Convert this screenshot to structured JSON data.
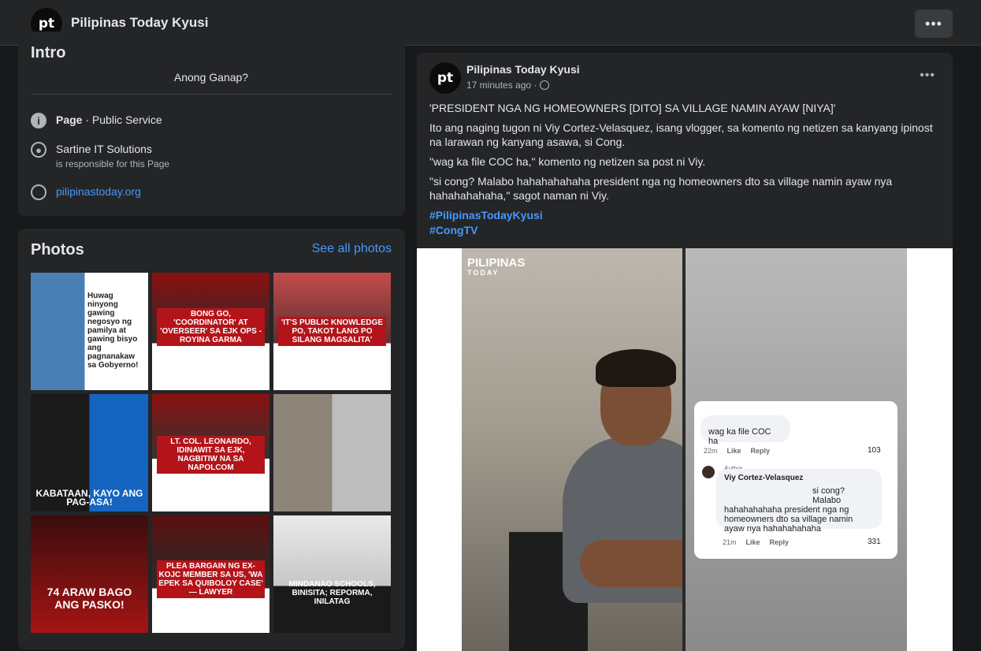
{
  "header": {
    "page_name": "Pilipinas Today Kyusi",
    "more_icon": "more-horizontal-icon"
  },
  "intro": {
    "title": "Intro",
    "bio": "Anong Ganap?",
    "category_label": "Page",
    "category_value": "Public Service",
    "manager_name": "Sartine IT Solutions",
    "manager_sub": "is responsible for this Page",
    "website": "pilipinastoday.org"
  },
  "photos": {
    "title": "Photos",
    "see_all": "See all photos",
    "items": [
      {
        "caption": "Huwag ninyong gawing negosyo ng pamilya at gawing bisyo ang pagnanakaw sa Gobyerno!"
      },
      {
        "caption": "BONG GO, 'COORDINATOR' AT 'OVERSEER' SA EJK OPS - ROYINA GARMA"
      },
      {
        "caption": "'IT'S PUBLIC KNOWLEDGE PO, TAKOT LANG PO SILANG MAGSALITA'"
      },
      {
        "caption": "KABATAAN, KAYO ANG PAG-ASA!"
      },
      {
        "caption": "LT. COL. LEONARDO, IDINAWIT SA EJK, NAGBITIW NA SA NAPOLCOM"
      },
      {
        "caption": ""
      },
      {
        "caption": "74 ARAW BAGO ANG PASKO!"
      },
      {
        "caption": "PLEA BARGAIN NG EX-KOJC MEMBER SA US, 'WA EPEK SA QUIBOLOY CASE' — LAWYER"
      },
      {
        "caption": "MINDANAO SCHOOLS, BINISITA; REPORMA, INILATAG"
      }
    ]
  },
  "post": {
    "author": "Pilipinas Today Kyusi",
    "time": "17 minutes ago ·",
    "headline": "'PRESIDENT NGA NG HOMEOWNERS [DITO] SA VILLAGE NAMIN AYAW [NIYA]'",
    "para1": "Ito ang naging tugon ni Viy Cortez-Velasquez, isang vlogger, sa komento ng netizen sa kanyang ipinost na larawan ng kanyang asawa, si Cong.",
    "para2": "\"wag ka file COC ha,\" komento ng netizen sa post ni Viy.",
    "para3": "\"si cong? Malabo hahahahahaha president nga ng homeowners dto sa village namin ayaw nya hahahahahaha,\" sagot naman ni Viy.",
    "hashtag1": "#PilipinasTodayKyusi",
    "hashtag2": "#CongTV"
  },
  "image": {
    "brand_line1": "PILIPINAS",
    "brand_line2": "TODAY",
    "comment1_text": "wag ka file COC ha",
    "comment1_time": "22m",
    "comment1_like": "Like",
    "comment1_reply": "Reply",
    "comment1_count": "103",
    "author_tag": "Author",
    "comment2_name": "Viy Cortez-Velasquez",
    "comment2_text_a": "si cong? Malabo",
    "comment2_text_b": "hahahahahaha president nga ng homeowners dto sa village namin ayaw nya hahahahahaha",
    "comment2_time": "21m",
    "comment2_like": "Like",
    "comment2_reply": "Reply",
    "comment2_count": "331"
  },
  "colors": {
    "background": "#18191a",
    "card": "#242526",
    "link": "#4599ff",
    "accent_red": "#b3141a"
  }
}
